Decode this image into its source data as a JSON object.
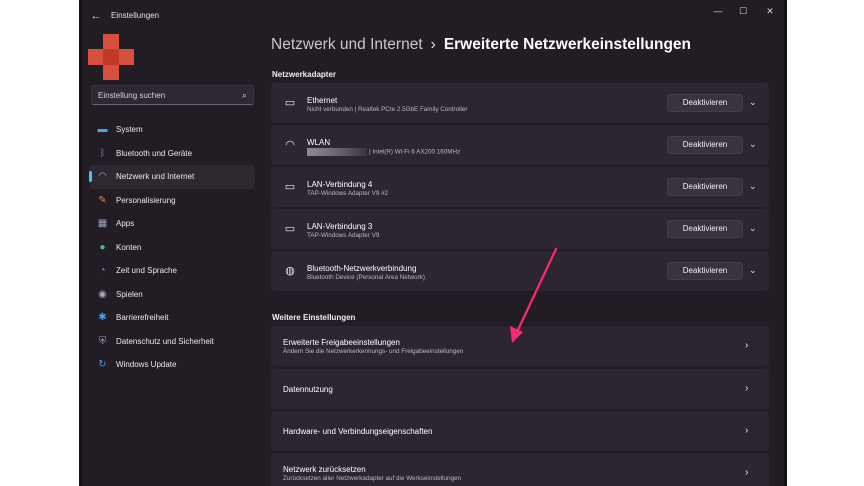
{
  "window": {
    "title": "Einstellungen",
    "back_icon": "←",
    "minimize_icon": "—",
    "maximize_icon": "☐",
    "close_icon": "✕"
  },
  "search": {
    "placeholder": "Einstellung suchen",
    "icon": "⌕"
  },
  "sidebar": {
    "items": [
      {
        "label": "System",
        "icon": "monitor-icon",
        "color": "#3fa6e8",
        "active": false
      },
      {
        "label": "Bluetooth und Geräte",
        "icon": "bluetooth-icon",
        "color": "#3f8ee8",
        "active": false
      },
      {
        "label": "Netzwerk und Internet",
        "icon": "wifi-icon",
        "color": "#6ab8e6",
        "active": true
      },
      {
        "label": "Personalisierung",
        "icon": "brush-icon",
        "color": "#e88a3f",
        "active": false
      },
      {
        "label": "Apps",
        "icon": "apps-icon",
        "color": "#9aa4c4",
        "active": false
      },
      {
        "label": "Konten",
        "icon": "person-icon",
        "color": "#3fc08a",
        "active": false
      },
      {
        "label": "Zeit und Sprache",
        "icon": "globe-clock-icon",
        "color": "#4aa8e0",
        "active": false
      },
      {
        "label": "Spielen",
        "icon": "gamepad-icon",
        "color": "#a8a8b4",
        "active": false
      },
      {
        "label": "Barrierefreiheit",
        "icon": "accessibility-icon",
        "color": "#4aa0ee",
        "active": false
      },
      {
        "label": "Datenschutz und Sicherheit",
        "icon": "shield-icon",
        "color": "#9aa0ae",
        "active": false
      },
      {
        "label": "Windows Update",
        "icon": "update-icon",
        "color": "#3f9ee8",
        "active": false
      }
    ]
  },
  "breadcrumb": {
    "parent": "Netzwerk und Internet",
    "separator": "›",
    "current": "Erweiterte Netzwerkeinstellungen"
  },
  "adapters_section": {
    "title": "Netzwerkadapter",
    "items": [
      {
        "name": "Ethernet",
        "desc": "Nicht verbunden | Realtek PCIe 2.5GbE Family Controller",
        "icon": "ethernet-icon",
        "button": "Deaktivieren",
        "redacted": false
      },
      {
        "name": "WLAN",
        "desc": "Intel(R) Wi-Fi 6 AX200 160MHz",
        "icon": "wifi-icon",
        "button": "Deaktivieren",
        "redacted": true
      },
      {
        "name": "LAN-Verbindung 4",
        "desc": "TAP-Windows Adapter V9 #2",
        "icon": "ethernet-icon",
        "button": "Deaktivieren",
        "redacted": false
      },
      {
        "name": "LAN-Verbindung 3",
        "desc": "TAP-Windows Adapter V9",
        "icon": "ethernet-icon",
        "button": "Deaktivieren",
        "redacted": false
      },
      {
        "name": "Bluetooth-Netzwerkverbindung",
        "desc": "Bluetooth Device (Personal Area Network)",
        "icon": "bluetooth-network-icon",
        "button": "Deaktivieren",
        "redacted": false
      }
    ]
  },
  "more_section": {
    "title": "Weitere Einstellungen",
    "items": [
      {
        "title": "Erweiterte Freigabeeinstellungen",
        "sub": "Ändern Sie die Netzwerkerkennungs- und Freigabeeinstellungen"
      },
      {
        "title": "Datennutzung",
        "sub": ""
      },
      {
        "title": "Hardware- und Verbindungseigenschaften",
        "sub": ""
      },
      {
        "title": "Netzwerk zurücksetzen",
        "sub": "Zurücksetzen aller Netzwerkadapter auf die Werkseinstellungen"
      }
    ]
  },
  "colors": {
    "accent": "#4cc2ff",
    "annotation_arrow": "#ff2a6d"
  }
}
